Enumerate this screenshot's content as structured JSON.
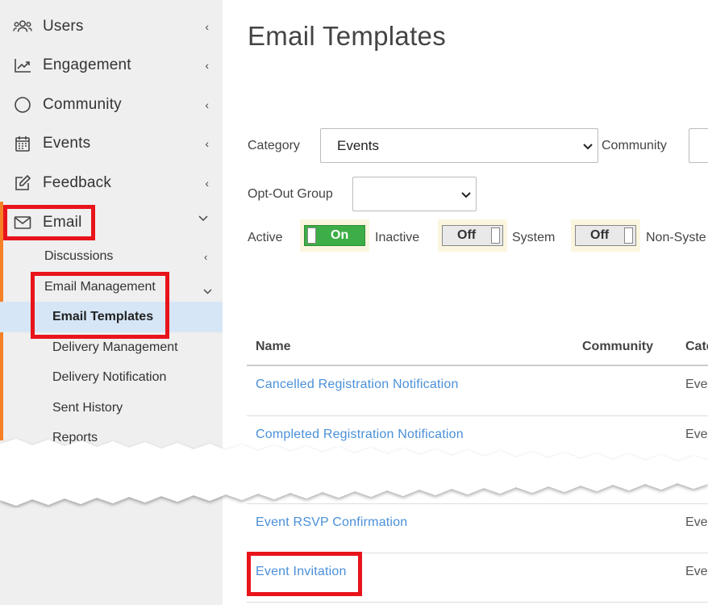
{
  "sidebar": {
    "nav": [
      {
        "label": "Users",
        "icon": "users-icon"
      },
      {
        "label": "Engagement",
        "icon": "chart-line-icon"
      },
      {
        "label": "Community",
        "icon": "circle-icon"
      },
      {
        "label": "Events",
        "icon": "calendar-icon"
      },
      {
        "label": "Feedback",
        "icon": "edit-icon"
      },
      {
        "label": "Email",
        "icon": "envelope-icon"
      }
    ],
    "email_sub": {
      "discussions": "Discussions",
      "email_management": "Email Management",
      "email_templates": "Email Templates",
      "delivery_management": "Delivery Management",
      "delivery_notification": "Delivery Notification",
      "sent_history": "Sent History",
      "reports": "Reports"
    },
    "chevron_left": "‹",
    "chevron_down": "⌄"
  },
  "page": {
    "title": "Email Templates"
  },
  "filters": {
    "category_label": "Category",
    "category_value": "Events",
    "community_label": "Community",
    "opt_out_label": "Opt-Out Group",
    "opt_out_value": "",
    "active_label": "Active",
    "active_state": "On",
    "inactive_label": "Inactive",
    "inactive_state": "Off",
    "system_label": "System",
    "system_state": "Off",
    "non_system_label": "Non-Syste"
  },
  "table": {
    "headers": {
      "name": "Name",
      "community": "Community",
      "category": "Cate"
    },
    "rows": [
      {
        "name": "Cancelled Registration Notification",
        "category": "Eve"
      },
      {
        "name": "Completed Registration Notification",
        "category": "Eve"
      },
      {
        "name": "Event RSVP Confirmation",
        "category": "Eve"
      },
      {
        "name": "Event Invitation",
        "category": "Eve"
      }
    ]
  },
  "colors": {
    "accent": "#f58025",
    "highlight": "#e8141b",
    "link": "#4a90d9",
    "toggle_on": "#3dae47",
    "selected_bg": "#d6e6f6"
  }
}
